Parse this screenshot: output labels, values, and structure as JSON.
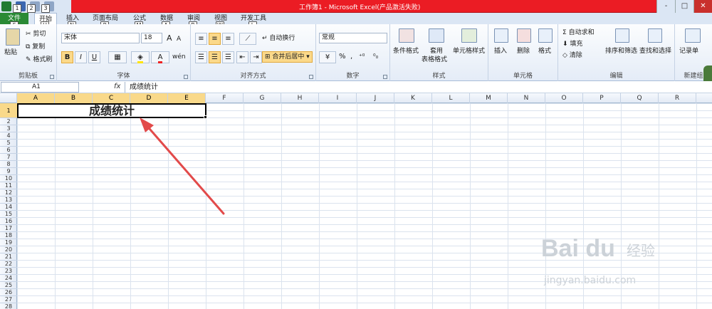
{
  "titlebar": {
    "title": "工作簿1  -  Microsoft Excel(产品激活失败)",
    "keytips": [
      "1",
      "2",
      "3"
    ],
    "window_buttons": [
      "-",
      "□",
      "✕"
    ]
  },
  "tabs": [
    {
      "label": "文件",
      "key": "F"
    },
    {
      "label": "开始",
      "key": "H"
    },
    {
      "label": "插入",
      "key": "N"
    },
    {
      "label": "页面布局",
      "key": "P"
    },
    {
      "label": "公式",
      "key": "M"
    },
    {
      "label": "数据",
      "key": "A"
    },
    {
      "label": "审阅",
      "key": "R"
    },
    {
      "label": "视图",
      "key": "W"
    },
    {
      "label": "开发工具",
      "key": "L"
    }
  ],
  "ribbon": {
    "clipboard": {
      "paste": "粘贴",
      "cut": "剪切",
      "copy": "复制",
      "format_painter": "格式刷",
      "label": "剪贴板"
    },
    "font": {
      "name": "宋体",
      "size": "18",
      "bold": "B",
      "italic": "I",
      "underline": "U",
      "grow": "A",
      "shrink": "A",
      "font_color": "A",
      "phonetic": "wén",
      "label": "字体"
    },
    "alignment": {
      "wrap": "自动换行",
      "merge": "合并后居中",
      "label": "对齐方式"
    },
    "number": {
      "format": "常规",
      "percent": "%",
      "comma": ",",
      "label": "数字"
    },
    "styles": {
      "conditional": "条件格式",
      "table_line1": "套用",
      "table_line2": "表格格式",
      "cell": "单元格样式",
      "label": "样式"
    },
    "cells": {
      "insert": "插入",
      "delete": "删除",
      "format": "格式",
      "label": "单元格"
    },
    "editing": {
      "autosum": "自动求和",
      "fill": "填充",
      "clear": "清除",
      "sort": "排序和筛选",
      "find": "查找和选择",
      "label": "编辑"
    },
    "newgroup": {
      "record": "记录单",
      "label": "新建组"
    }
  },
  "formula_bar": {
    "cell_ref": "A1",
    "fx": "fx",
    "content": "成绩统计"
  },
  "grid": {
    "columns": [
      "A",
      "B",
      "C",
      "D",
      "E",
      "F",
      "G",
      "H",
      "I",
      "J",
      "K",
      "L",
      "M",
      "N",
      "O",
      "P",
      "Q",
      "R"
    ],
    "rows": [
      "1",
      "2",
      "3",
      "4",
      "5",
      "6",
      "7",
      "8",
      "9",
      "10",
      "11",
      "12",
      "13",
      "14",
      "15",
      "16",
      "17",
      "18",
      "19",
      "20",
      "21",
      "22",
      "23",
      "24",
      "25",
      "26",
      "27",
      "28"
    ],
    "selected_columns": [
      "A",
      "B",
      "C",
      "D",
      "E"
    ],
    "selected_row": "1",
    "merged_cell_text": "成绩统计"
  },
  "watermark": {
    "brand": "Bai  du",
    "cn": "经验",
    "url": "jingyan.baidu.com"
  },
  "colors": {
    "title_bar": "#eb1c24",
    "file_tab": "#2a8a35",
    "selection_header": "#f9d98a",
    "arrow": "#e24a4a"
  }
}
